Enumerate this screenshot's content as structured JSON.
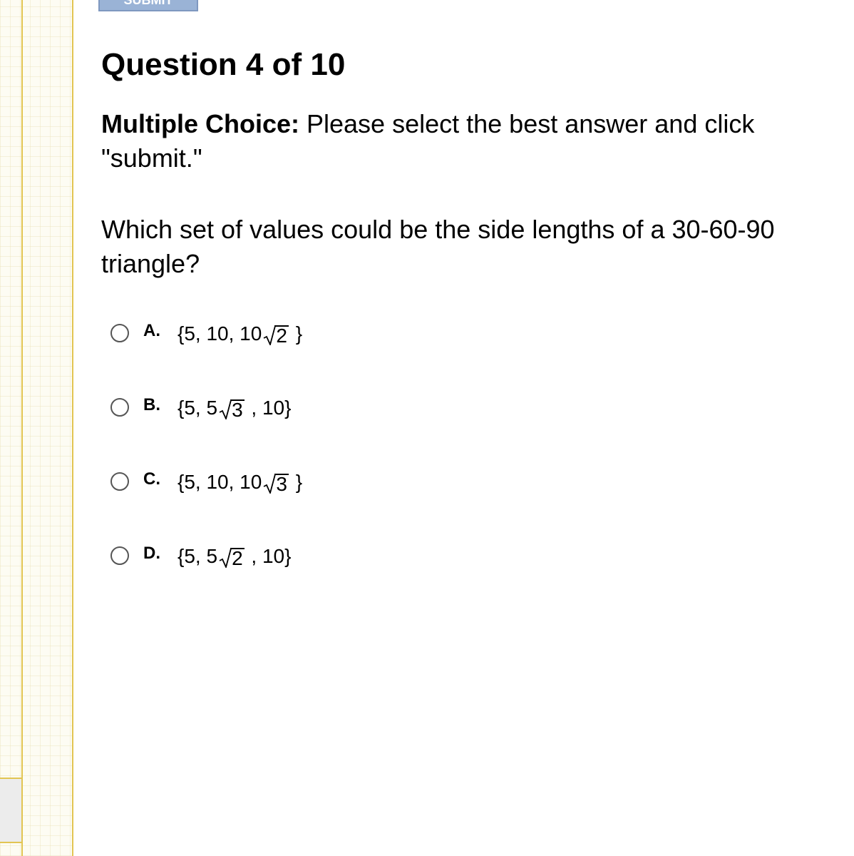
{
  "header": {
    "submit_label": "SUBMIT"
  },
  "question": {
    "title": "Question 4 of 10",
    "instructions_bold": "Multiple Choice:",
    "instructions_text": " Please select the best answer and click \"submit.\"",
    "prompt": "Which set of values could be the side lengths of a 30-60-90 triangle?"
  },
  "choices": [
    {
      "letter": "A.",
      "before": "{5, 10, 10",
      "radicand": "2",
      "after": " }"
    },
    {
      "letter": "B.",
      "before": "{5, 5",
      "radicand": "3",
      "after": " , 10}"
    },
    {
      "letter": "C.",
      "before": "{5, 10, 10",
      "radicand": "3",
      "after": " }"
    },
    {
      "letter": "D.",
      "before": "{5, 5",
      "radicand": "2",
      "after": " , 10}"
    }
  ]
}
